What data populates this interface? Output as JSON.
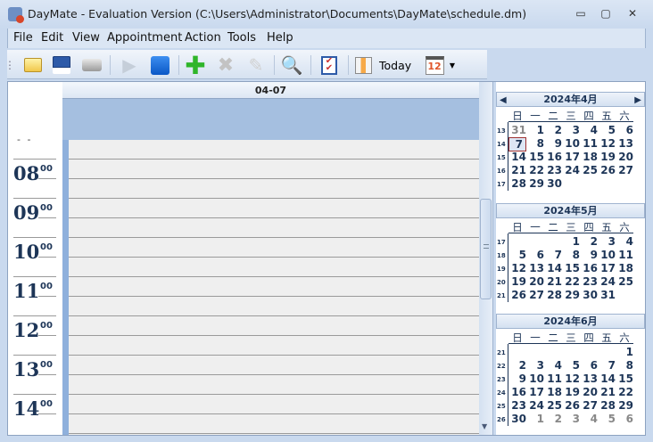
{
  "window": {
    "title": "DayMate - Evaluation Version (C:\\Users\\Administrator\\Documents\\DayMate\\schedule.dm)",
    "minimize": "▭",
    "maximize": "▢",
    "close": "✕"
  },
  "menu": [
    "File",
    "Edit",
    "View",
    "Appointment",
    "Action",
    "Tools",
    "Help"
  ],
  "toolbar": {
    "today_label": "Today",
    "calendar_icon_text": "12"
  },
  "day_view": {
    "date_header": "04-07",
    "pre_label": "- -",
    "hours": [
      "08",
      "09",
      "10",
      "11",
      "12",
      "13",
      "14"
    ],
    "minutes": "00"
  },
  "day_names": [
    "日",
    "一",
    "二",
    "三",
    "四",
    "五",
    "六"
  ],
  "months": [
    {
      "title": "2024年4月",
      "weeks": [
        {
          "wk": "13",
          "days": [
            {
              "d": "31",
              "dim": true
            },
            {
              "d": "1"
            },
            {
              "d": "2"
            },
            {
              "d": "3"
            },
            {
              "d": "4"
            },
            {
              "d": "5"
            },
            {
              "d": "6"
            }
          ]
        },
        {
          "wk": "14",
          "days": [
            {
              "d": "7",
              "today": true
            },
            {
              "d": "8"
            },
            {
              "d": "9"
            },
            {
              "d": "10"
            },
            {
              "d": "11"
            },
            {
              "d": "12"
            },
            {
              "d": "13"
            }
          ]
        },
        {
          "wk": "15",
          "days": [
            {
              "d": "14"
            },
            {
              "d": "15"
            },
            {
              "d": "16"
            },
            {
              "d": "17"
            },
            {
              "d": "18"
            },
            {
              "d": "19"
            },
            {
              "d": "20"
            }
          ]
        },
        {
          "wk": "16",
          "days": [
            {
              "d": "21"
            },
            {
              "d": "22"
            },
            {
              "d": "23"
            },
            {
              "d": "24"
            },
            {
              "d": "25"
            },
            {
              "d": "26"
            },
            {
              "d": "27"
            }
          ]
        },
        {
          "wk": "17",
          "days": [
            {
              "d": "28"
            },
            {
              "d": "29"
            },
            {
              "d": "30"
            },
            null,
            null,
            null,
            null
          ]
        }
      ]
    },
    {
      "title": "2024年5月",
      "weeks": [
        {
          "wk": "17",
          "days": [
            null,
            null,
            null,
            {
              "d": "1"
            },
            {
              "d": "2"
            },
            {
              "d": "3"
            },
            {
              "d": "4"
            }
          ]
        },
        {
          "wk": "18",
          "days": [
            {
              "d": "5"
            },
            {
              "d": "6"
            },
            {
              "d": "7"
            },
            {
              "d": "8"
            },
            {
              "d": "9"
            },
            {
              "d": "10"
            },
            {
              "d": "11"
            }
          ]
        },
        {
          "wk": "19",
          "days": [
            {
              "d": "12"
            },
            {
              "d": "13"
            },
            {
              "d": "14"
            },
            {
              "d": "15"
            },
            {
              "d": "16"
            },
            {
              "d": "17"
            },
            {
              "d": "18"
            }
          ]
        },
        {
          "wk": "20",
          "days": [
            {
              "d": "19"
            },
            {
              "d": "20"
            },
            {
              "d": "21"
            },
            {
              "d": "22"
            },
            {
              "d": "23"
            },
            {
              "d": "24"
            },
            {
              "d": "25"
            }
          ]
        },
        {
          "wk": "21",
          "days": [
            {
              "d": "26"
            },
            {
              "d": "27"
            },
            {
              "d": "28"
            },
            {
              "d": "29"
            },
            {
              "d": "30"
            },
            {
              "d": "31"
            },
            null
          ]
        }
      ]
    },
    {
      "title": "2024年6月",
      "weeks": [
        {
          "wk": "21",
          "days": [
            null,
            null,
            null,
            null,
            null,
            null,
            {
              "d": "1"
            }
          ]
        },
        {
          "wk": "22",
          "days": [
            {
              "d": "2"
            },
            {
              "d": "3"
            },
            {
              "d": "4"
            },
            {
              "d": "5"
            },
            {
              "d": "6"
            },
            {
              "d": "7"
            },
            {
              "d": "8"
            }
          ]
        },
        {
          "wk": "23",
          "days": [
            {
              "d": "9"
            },
            {
              "d": "10"
            },
            {
              "d": "11"
            },
            {
              "d": "12"
            },
            {
              "d": "13"
            },
            {
              "d": "14"
            },
            {
              "d": "15"
            }
          ]
        },
        {
          "wk": "24",
          "days": [
            {
              "d": "16"
            },
            {
              "d": "17"
            },
            {
              "d": "18"
            },
            {
              "d": "19"
            },
            {
              "d": "20"
            },
            {
              "d": "21"
            },
            {
              "d": "22"
            }
          ]
        },
        {
          "wk": "25",
          "days": [
            {
              "d": "23"
            },
            {
              "d": "24"
            },
            {
              "d": "25"
            },
            {
              "d": "26"
            },
            {
              "d": "27"
            },
            {
              "d": "28"
            },
            {
              "d": "29"
            }
          ]
        },
        {
          "wk": "26",
          "days": [
            {
              "d": "30"
            },
            {
              "d": "1",
              "dim": true
            },
            {
              "d": "2",
              "dim": true
            },
            {
              "d": "3",
              "dim": true
            },
            {
              "d": "4",
              "dim": true
            },
            {
              "d": "5",
              "dim": true
            },
            {
              "d": "6",
              "dim": true
            }
          ]
        }
      ]
    }
  ]
}
